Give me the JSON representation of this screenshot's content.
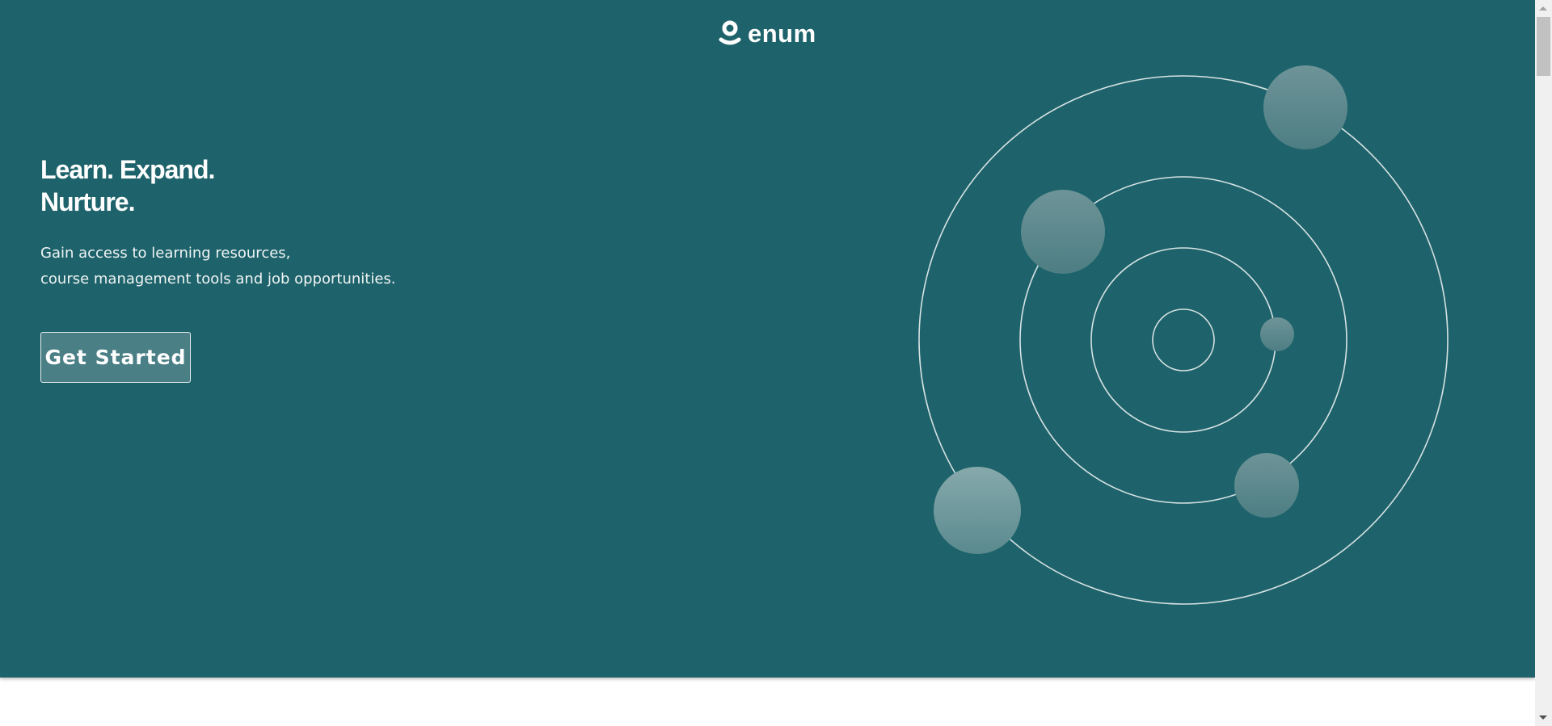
{
  "header": {
    "logo_text": "enum",
    "logo_icon": "person-smile-icon"
  },
  "hero": {
    "headline_line1": "Learn. Expand.",
    "headline_line2": "Nurture.",
    "subtitle_line1": "Gain access to learning resources,",
    "subtitle_line2": "course management tools and job opportunities.",
    "cta_label": "Get Started"
  },
  "colors": {
    "background": "#1e636b",
    "button": "#4a7f85",
    "text": "#ffffff"
  }
}
